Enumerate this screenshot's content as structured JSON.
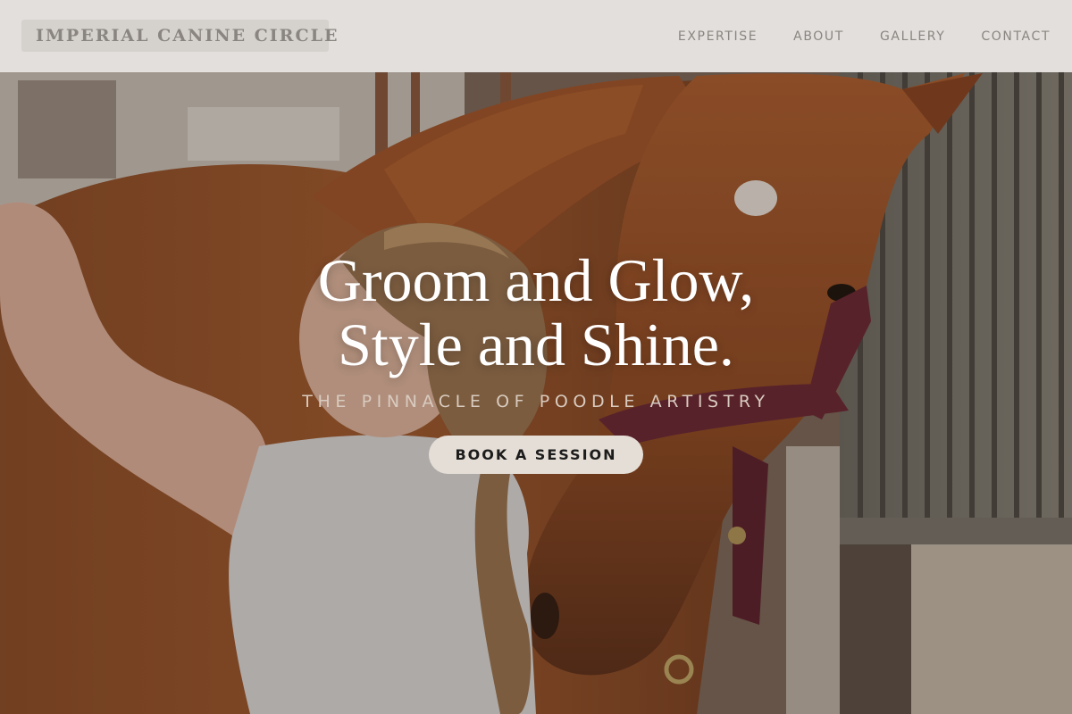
{
  "brand": {
    "name": "IMPERIAL CANINE CIRCLE"
  },
  "nav": {
    "items": [
      {
        "label": "EXPERTISE"
      },
      {
        "label": "ABOUT"
      },
      {
        "label": "GALLERY"
      },
      {
        "label": "CONTACT"
      }
    ]
  },
  "hero": {
    "title_line1": "Groom and Glow,",
    "title_line2": "Style and Shine.",
    "tagline": "THE PINNACLE OF POODLE ARTISTRY",
    "cta_label": "BOOK A SESSION",
    "image": "woman-grooming-chestnut-horse-in-stable"
  },
  "colors": {
    "nav_bg": "#eceae7",
    "nav_text": "#8a8580",
    "hero_title": "#ffffff",
    "tagline": "#d9cbbf",
    "cta_bg": "#e5ded6",
    "cta_text": "#1c1c1c"
  }
}
